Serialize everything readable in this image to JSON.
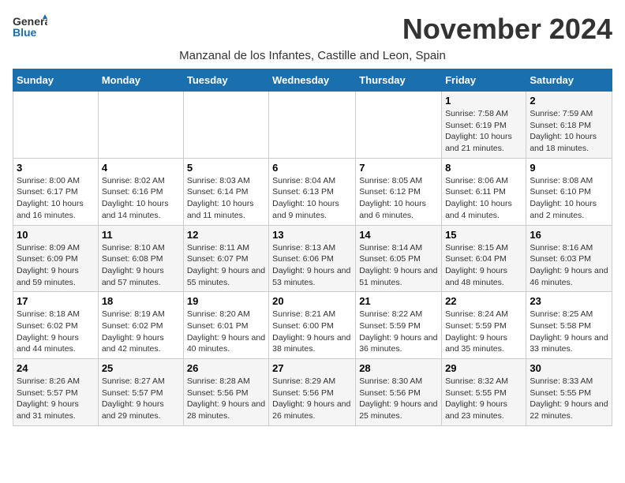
{
  "logo": {
    "general": "General",
    "blue": "Blue"
  },
  "title": "November 2024",
  "subtitle": "Manzanal de los Infantes, Castille and Leon, Spain",
  "days_of_week": [
    "Sunday",
    "Monday",
    "Tuesday",
    "Wednesday",
    "Thursday",
    "Friday",
    "Saturday"
  ],
  "weeks": [
    [
      {
        "num": "",
        "info": ""
      },
      {
        "num": "",
        "info": ""
      },
      {
        "num": "",
        "info": ""
      },
      {
        "num": "",
        "info": ""
      },
      {
        "num": "",
        "info": ""
      },
      {
        "num": "1",
        "info": "Sunrise: 7:58 AM\nSunset: 6:19 PM\nDaylight: 10 hours and 21 minutes."
      },
      {
        "num": "2",
        "info": "Sunrise: 7:59 AM\nSunset: 6:18 PM\nDaylight: 10 hours and 18 minutes."
      }
    ],
    [
      {
        "num": "3",
        "info": "Sunrise: 8:00 AM\nSunset: 6:17 PM\nDaylight: 10 hours and 16 minutes."
      },
      {
        "num": "4",
        "info": "Sunrise: 8:02 AM\nSunset: 6:16 PM\nDaylight: 10 hours and 14 minutes."
      },
      {
        "num": "5",
        "info": "Sunrise: 8:03 AM\nSunset: 6:14 PM\nDaylight: 10 hours and 11 minutes."
      },
      {
        "num": "6",
        "info": "Sunrise: 8:04 AM\nSunset: 6:13 PM\nDaylight: 10 hours and 9 minutes."
      },
      {
        "num": "7",
        "info": "Sunrise: 8:05 AM\nSunset: 6:12 PM\nDaylight: 10 hours and 6 minutes."
      },
      {
        "num": "8",
        "info": "Sunrise: 8:06 AM\nSunset: 6:11 PM\nDaylight: 10 hours and 4 minutes."
      },
      {
        "num": "9",
        "info": "Sunrise: 8:08 AM\nSunset: 6:10 PM\nDaylight: 10 hours and 2 minutes."
      }
    ],
    [
      {
        "num": "10",
        "info": "Sunrise: 8:09 AM\nSunset: 6:09 PM\nDaylight: 9 hours and 59 minutes."
      },
      {
        "num": "11",
        "info": "Sunrise: 8:10 AM\nSunset: 6:08 PM\nDaylight: 9 hours and 57 minutes."
      },
      {
        "num": "12",
        "info": "Sunrise: 8:11 AM\nSunset: 6:07 PM\nDaylight: 9 hours and 55 minutes."
      },
      {
        "num": "13",
        "info": "Sunrise: 8:13 AM\nSunset: 6:06 PM\nDaylight: 9 hours and 53 minutes."
      },
      {
        "num": "14",
        "info": "Sunrise: 8:14 AM\nSunset: 6:05 PM\nDaylight: 9 hours and 51 minutes."
      },
      {
        "num": "15",
        "info": "Sunrise: 8:15 AM\nSunset: 6:04 PM\nDaylight: 9 hours and 48 minutes."
      },
      {
        "num": "16",
        "info": "Sunrise: 8:16 AM\nSunset: 6:03 PM\nDaylight: 9 hours and 46 minutes."
      }
    ],
    [
      {
        "num": "17",
        "info": "Sunrise: 8:18 AM\nSunset: 6:02 PM\nDaylight: 9 hours and 44 minutes."
      },
      {
        "num": "18",
        "info": "Sunrise: 8:19 AM\nSunset: 6:02 PM\nDaylight: 9 hours and 42 minutes."
      },
      {
        "num": "19",
        "info": "Sunrise: 8:20 AM\nSunset: 6:01 PM\nDaylight: 9 hours and 40 minutes."
      },
      {
        "num": "20",
        "info": "Sunrise: 8:21 AM\nSunset: 6:00 PM\nDaylight: 9 hours and 38 minutes."
      },
      {
        "num": "21",
        "info": "Sunrise: 8:22 AM\nSunset: 5:59 PM\nDaylight: 9 hours and 36 minutes."
      },
      {
        "num": "22",
        "info": "Sunrise: 8:24 AM\nSunset: 5:59 PM\nDaylight: 9 hours and 35 minutes."
      },
      {
        "num": "23",
        "info": "Sunrise: 8:25 AM\nSunset: 5:58 PM\nDaylight: 9 hours and 33 minutes."
      }
    ],
    [
      {
        "num": "24",
        "info": "Sunrise: 8:26 AM\nSunset: 5:57 PM\nDaylight: 9 hours and 31 minutes."
      },
      {
        "num": "25",
        "info": "Sunrise: 8:27 AM\nSunset: 5:57 PM\nDaylight: 9 hours and 29 minutes."
      },
      {
        "num": "26",
        "info": "Sunrise: 8:28 AM\nSunset: 5:56 PM\nDaylight: 9 hours and 28 minutes."
      },
      {
        "num": "27",
        "info": "Sunrise: 8:29 AM\nSunset: 5:56 PM\nDaylight: 9 hours and 26 minutes."
      },
      {
        "num": "28",
        "info": "Sunrise: 8:30 AM\nSunset: 5:56 PM\nDaylight: 9 hours and 25 minutes."
      },
      {
        "num": "29",
        "info": "Sunrise: 8:32 AM\nSunset: 5:55 PM\nDaylight: 9 hours and 23 minutes."
      },
      {
        "num": "30",
        "info": "Sunrise: 8:33 AM\nSunset: 5:55 PM\nDaylight: 9 hours and 22 minutes."
      }
    ]
  ]
}
